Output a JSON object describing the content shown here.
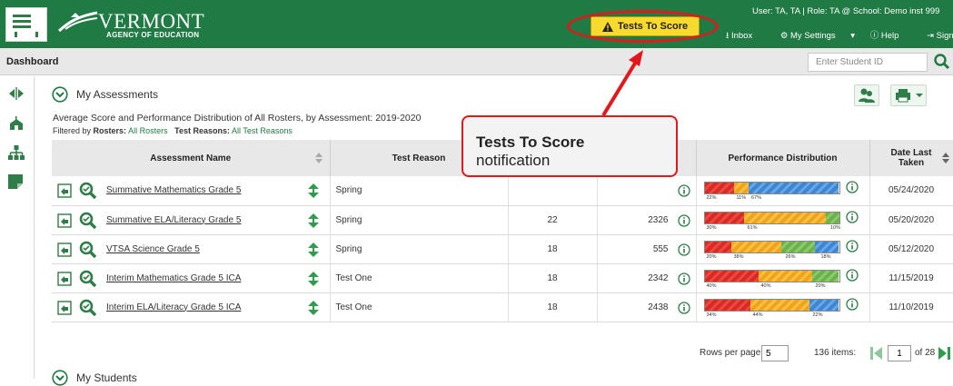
{
  "header": {
    "logo_title": "VERMONT",
    "logo_subtitle": "AGENCY OF EDUCATION",
    "tests_to_score_label": "Tests To Score",
    "user_info": "User: TA, TA  |  Role: TA @ School: Demo inst 999",
    "links": {
      "inbox": "Inbox",
      "settings": "My Settings",
      "help": "Help",
      "signout": "Sign Ou"
    }
  },
  "dashboard": {
    "title": "Dashboard",
    "student_id_placeholder": "Enter Student ID"
  },
  "section": {
    "title": "My Assessments",
    "subtitle": "Average Score and Performance Distribution of All Rosters, by Assessment: 2019-2020",
    "filter_prefix": "Filtered by",
    "rosters_label": "Rosters:",
    "rosters_value": "All Rosters",
    "reasons_label": "Test Reasons:",
    "reasons_value": "All Test Reasons"
  },
  "table": {
    "headers": {
      "name": "Assessment Name",
      "reason": "Test Reason",
      "perf": "Performance Distribution",
      "date_line1": "Date Last",
      "date_line2": "Taken"
    },
    "rows": [
      {
        "name": "Summative Mathematics Grade 5",
        "reason": "Spring",
        "students": "",
        "score": "",
        "date": "05/24/2020",
        "perf": [
          22,
          11,
          67
        ],
        "perf_labels": [
          "22%",
          "11%",
          "67%"
        ],
        "perf_colors": [
          "red",
          "orange",
          "blue"
        ]
      },
      {
        "name": "Summative ELA/Literacy Grade 5",
        "reason": "Spring",
        "students": "22",
        "score": "2326",
        "date": "05/20/2020",
        "perf": [
          30,
          61,
          10
        ],
        "perf_labels": [
          "30%",
          "61%",
          "10%"
        ],
        "perf_colors": [
          "red",
          "orange",
          "green"
        ]
      },
      {
        "name": "VTSA Science Grade 5",
        "reason": "Spring",
        "students": "18",
        "score": "555",
        "date": "05/12/2020",
        "perf": [
          20,
          38,
          26,
          18
        ],
        "perf_labels": [
          "20%",
          "38%",
          "26%",
          "18%"
        ],
        "perf_colors": [
          "red",
          "orange",
          "green",
          "blue"
        ]
      },
      {
        "name": "Interim Mathematics Grade 5 ICA",
        "reason": "Test One",
        "students": "18",
        "score": "2342",
        "date": "11/15/2019",
        "perf": [
          40,
          40,
          20
        ],
        "perf_labels": [
          "40%",
          "40%",
          "20%"
        ],
        "perf_colors": [
          "red",
          "orange",
          "green"
        ]
      },
      {
        "name": "Interim ELA/Literacy Grade 5 ICA",
        "reason": "Test One",
        "students": "18",
        "score": "2438",
        "date": "11/10/2019",
        "perf": [
          34,
          44,
          22
        ],
        "perf_labels": [
          "34%",
          "44%",
          "22%"
        ],
        "perf_colors": [
          "red",
          "orange",
          "blue"
        ]
      }
    ]
  },
  "pager": {
    "rows_label": "Rows per page:",
    "rows_value": "5",
    "items": "136 items:",
    "page": "1",
    "of_pages": "of 28"
  },
  "next_section": "My Students",
  "callout": {
    "title": "Tests To Score",
    "subtitle": "notification"
  },
  "colors": {
    "header_green": "#1f7a43",
    "tts_yellow": "#f7da2d",
    "annotation_red": "#e3171c"
  }
}
